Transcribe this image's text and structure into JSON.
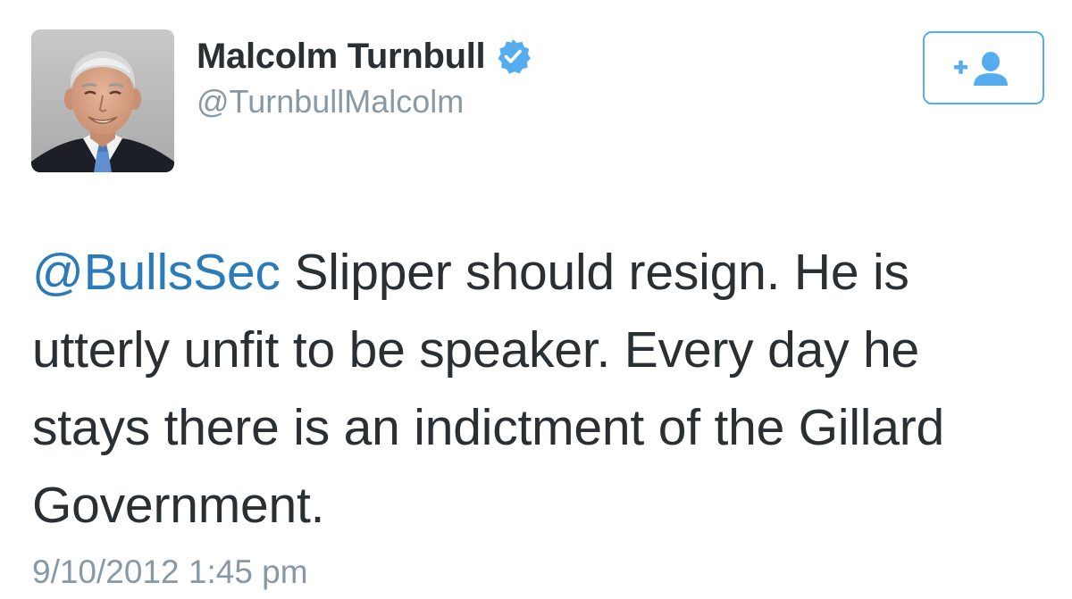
{
  "author": {
    "display_name": "Malcolm Turnbull",
    "handle": "@TurnbullMalcolm",
    "verified": true
  },
  "follow_button": {
    "icon": "add-user-icon"
  },
  "tweet": {
    "mention": "@BullsSec",
    "lines": [
      " Slipper should resign. He is",
      "utterly unfit to be speaker. Every day he",
      "stays there is an indictment of the Gillard",
      "Government."
    ],
    "timestamp": "9/10/2012 1:45 pm"
  },
  "colors": {
    "accent": "#55acee",
    "mention": "#2b7bb9",
    "text": "#292f33",
    "muted": "#8899a6"
  }
}
